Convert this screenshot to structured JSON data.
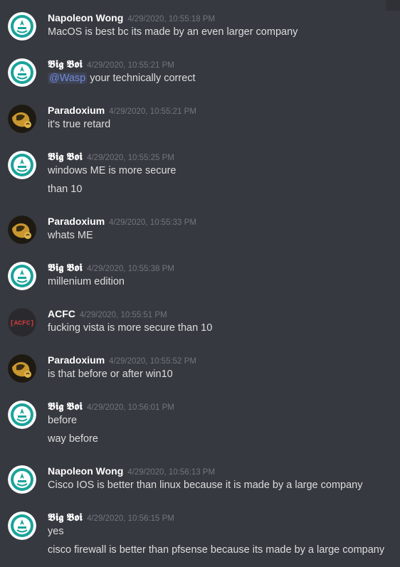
{
  "colors": {
    "background": "#36393f",
    "username": "#ffffff",
    "timestamp": "#72767d",
    "text": "#dcddde",
    "mention": "#7289da"
  },
  "messages": [
    {
      "author": "Napoleon Wong",
      "avatar": "seal-avatar",
      "timestamp": "4/29/2020, 10:55:18 PM",
      "lines": [
        "MacOS is best bc its made by an even larger company"
      ]
    },
    {
      "author": "𝕭𝖎𝖌 𝕭𝖔𝖎",
      "avatar": "seal-avatar",
      "timestamp": "4/29/2020, 10:55:21 PM",
      "mention": "@Wasp",
      "lines": [
        " your technically correct"
      ]
    },
    {
      "author": "Paradoxium",
      "avatar": "paradoxium-avatar",
      "timestamp": "4/29/2020, 10:55:21 PM",
      "lines": [
        "it's true retard"
      ]
    },
    {
      "author": "𝕭𝖎𝖌 𝕭𝖔𝖎",
      "avatar": "seal-avatar",
      "timestamp": "4/29/2020, 10:55:25 PM",
      "lines": [
        "windows ME is more secure",
        "than 10"
      ]
    },
    {
      "author": "Paradoxium",
      "avatar": "paradoxium-avatar",
      "timestamp": "4/29/2020, 10:55:33 PM",
      "lines": [
        "whats ME"
      ]
    },
    {
      "author": "𝕭𝖎𝖌 𝕭𝖔𝖎",
      "avatar": "seal-avatar",
      "timestamp": "4/29/2020, 10:55:38 PM",
      "lines": [
        "millenium edition"
      ]
    },
    {
      "author": "ACFC",
      "avatar": "acfc-avatar",
      "avatar_text": "[ACFC]",
      "timestamp": "4/29/2020, 10:55:51 PM",
      "lines": [
        "fucking vista is more secure than 10"
      ]
    },
    {
      "author": "Paradoxium",
      "avatar": "paradoxium-avatar",
      "timestamp": "4/29/2020, 10:55:52 PM",
      "lines": [
        "is that before or after win10"
      ]
    },
    {
      "author": "𝕭𝖎𝖌 𝕭𝖔𝖎",
      "avatar": "seal-avatar",
      "timestamp": "4/29/2020, 10:56:01 PM",
      "lines": [
        "before",
        "way before"
      ]
    },
    {
      "author": "Napoleon Wong",
      "avatar": "seal-avatar",
      "timestamp": "4/29/2020, 10:56:13 PM",
      "lines": [
        "Cisco IOS is better than linux because it is made by a large company"
      ]
    },
    {
      "author": "𝕭𝖎𝖌 𝕭𝖔𝖎",
      "avatar": "seal-avatar",
      "timestamp": "4/29/2020, 10:56:15 PM",
      "lines": [
        "yes",
        "cisco firewall is better than pfsense because its made by a large company"
      ]
    }
  ]
}
